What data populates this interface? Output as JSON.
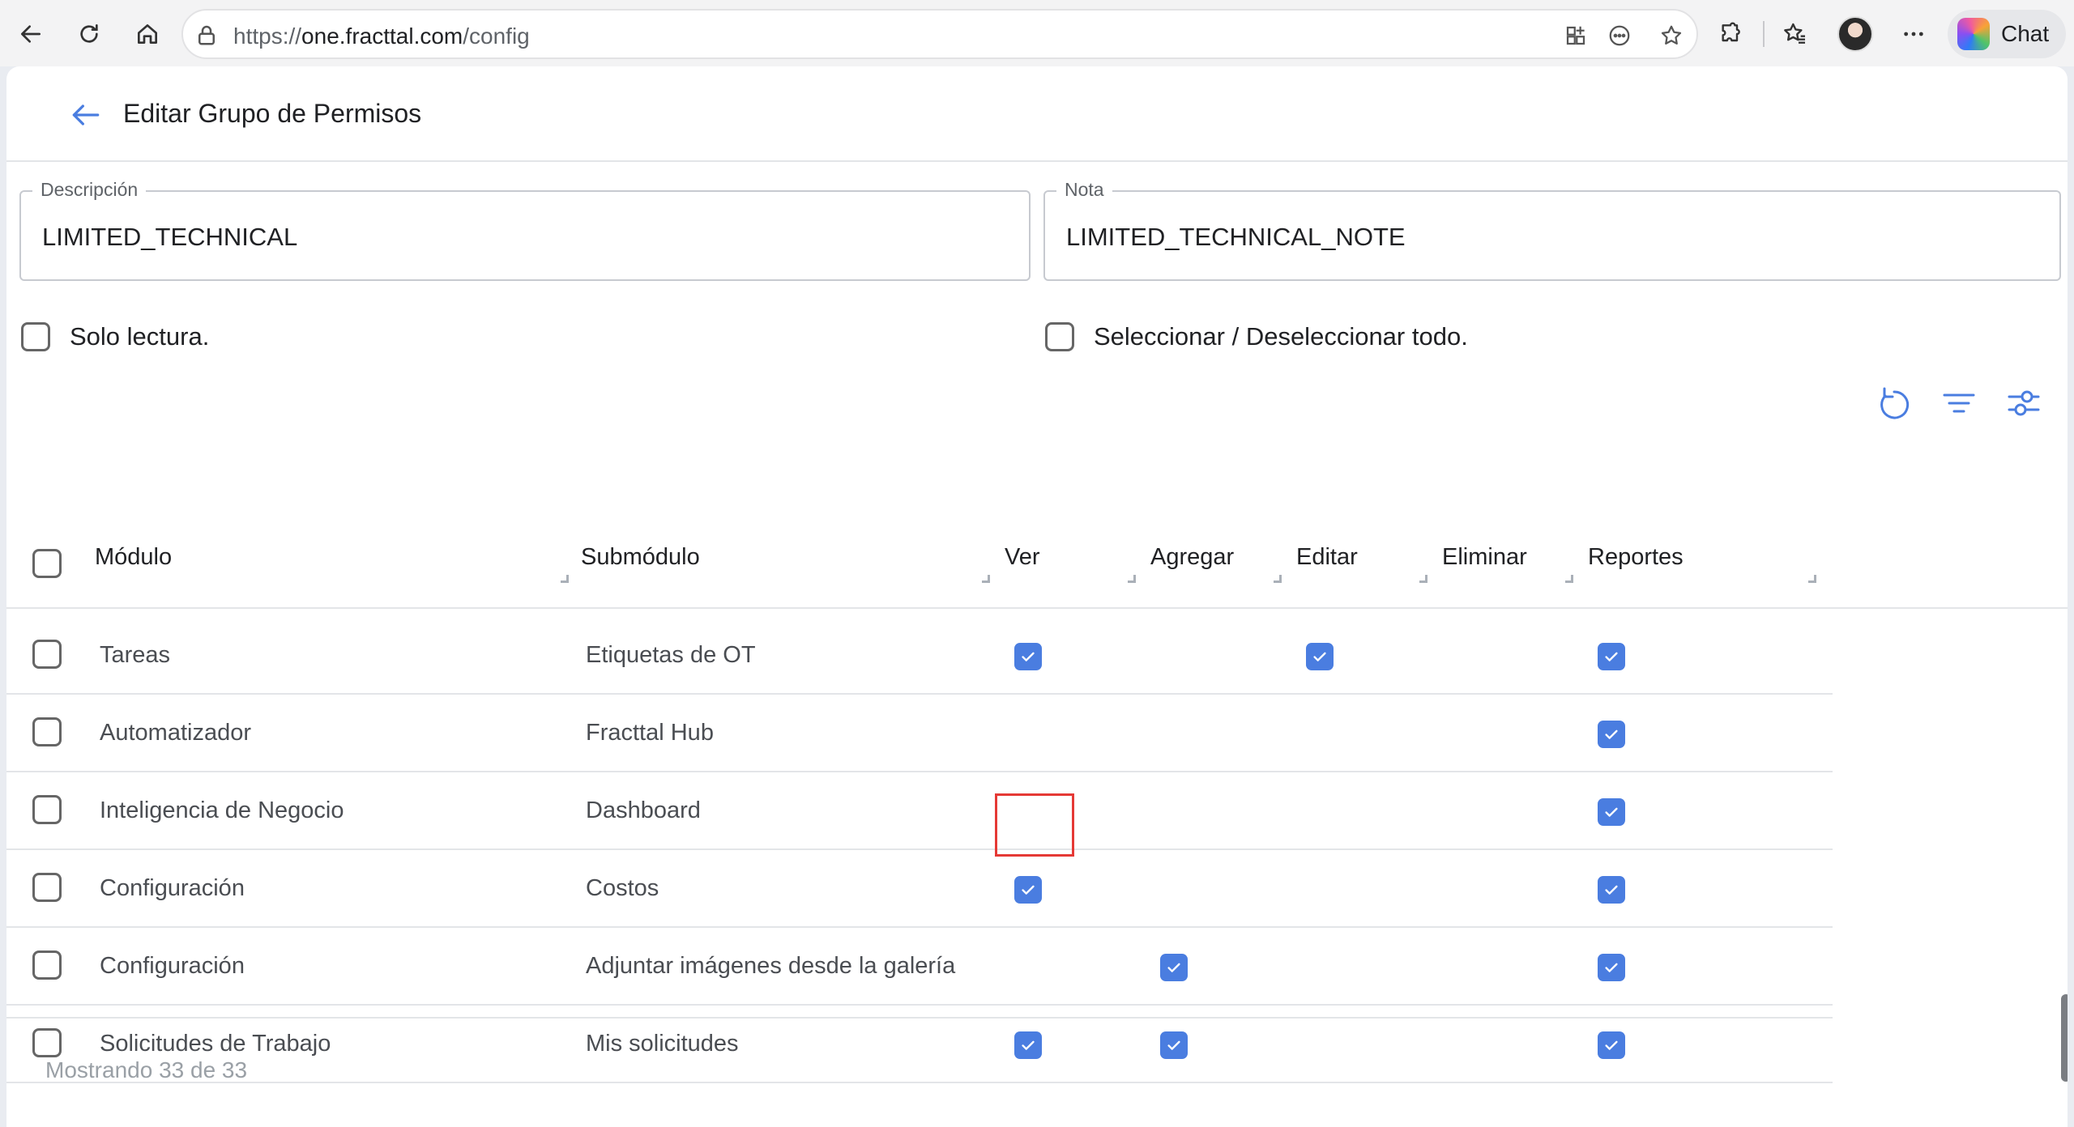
{
  "browser": {
    "url_scheme": "https://",
    "url_host": "one.fracttal.com",
    "url_path": "/config",
    "chat_label": "Chat"
  },
  "header": {
    "title": "Editar Grupo de Permisos"
  },
  "form": {
    "descripcion_label": "Descripción",
    "descripcion_value": "LIMITED_TECHNICAL",
    "nota_label": "Nota",
    "nota_value": "LIMITED_TECHNICAL_NOTE",
    "solo_lectura_label": "Solo lectura.",
    "select_all_label": "Seleccionar / Deseleccionar todo."
  },
  "table": {
    "columns": {
      "modulo": "Módulo",
      "submodulo": "Submódulo",
      "ver": "Ver",
      "agregar": "Agregar",
      "editar": "Editar",
      "eliminar": "Eliminar",
      "reportes": "Reportes"
    },
    "rows": [
      {
        "modulo": "Tareas",
        "submodulo": "Etiquetas de OT",
        "ver": true,
        "agregar": false,
        "editar": true,
        "eliminar": false,
        "reportes": true
      },
      {
        "modulo": "Automatizador",
        "submodulo": "Fracttal Hub",
        "ver": false,
        "agregar": false,
        "editar": false,
        "eliminar": false,
        "reportes": true
      },
      {
        "modulo": "Inteligencia de Negocio",
        "submodulo": "Dashboard",
        "ver": false,
        "agregar": false,
        "editar": false,
        "eliminar": false,
        "reportes": true
      },
      {
        "modulo": "Configuración",
        "submodulo": "Costos",
        "ver": true,
        "agregar": false,
        "editar": false,
        "eliminar": false,
        "reportes": true
      },
      {
        "modulo": "Configuración",
        "submodulo": "Adjuntar imágenes desde la galería",
        "ver": false,
        "agregar": true,
        "editar": false,
        "eliminar": false,
        "reportes": true
      },
      {
        "modulo": "Solicitudes de Trabajo",
        "submodulo": "Mis solicitudes",
        "ver": true,
        "agregar": true,
        "editar": false,
        "eliminar": false,
        "reportes": true
      }
    ]
  },
  "footer": {
    "status": "Mostrando 33 de 33"
  },
  "colors": {
    "accent": "#4a7de0",
    "highlight": "#e53935"
  }
}
